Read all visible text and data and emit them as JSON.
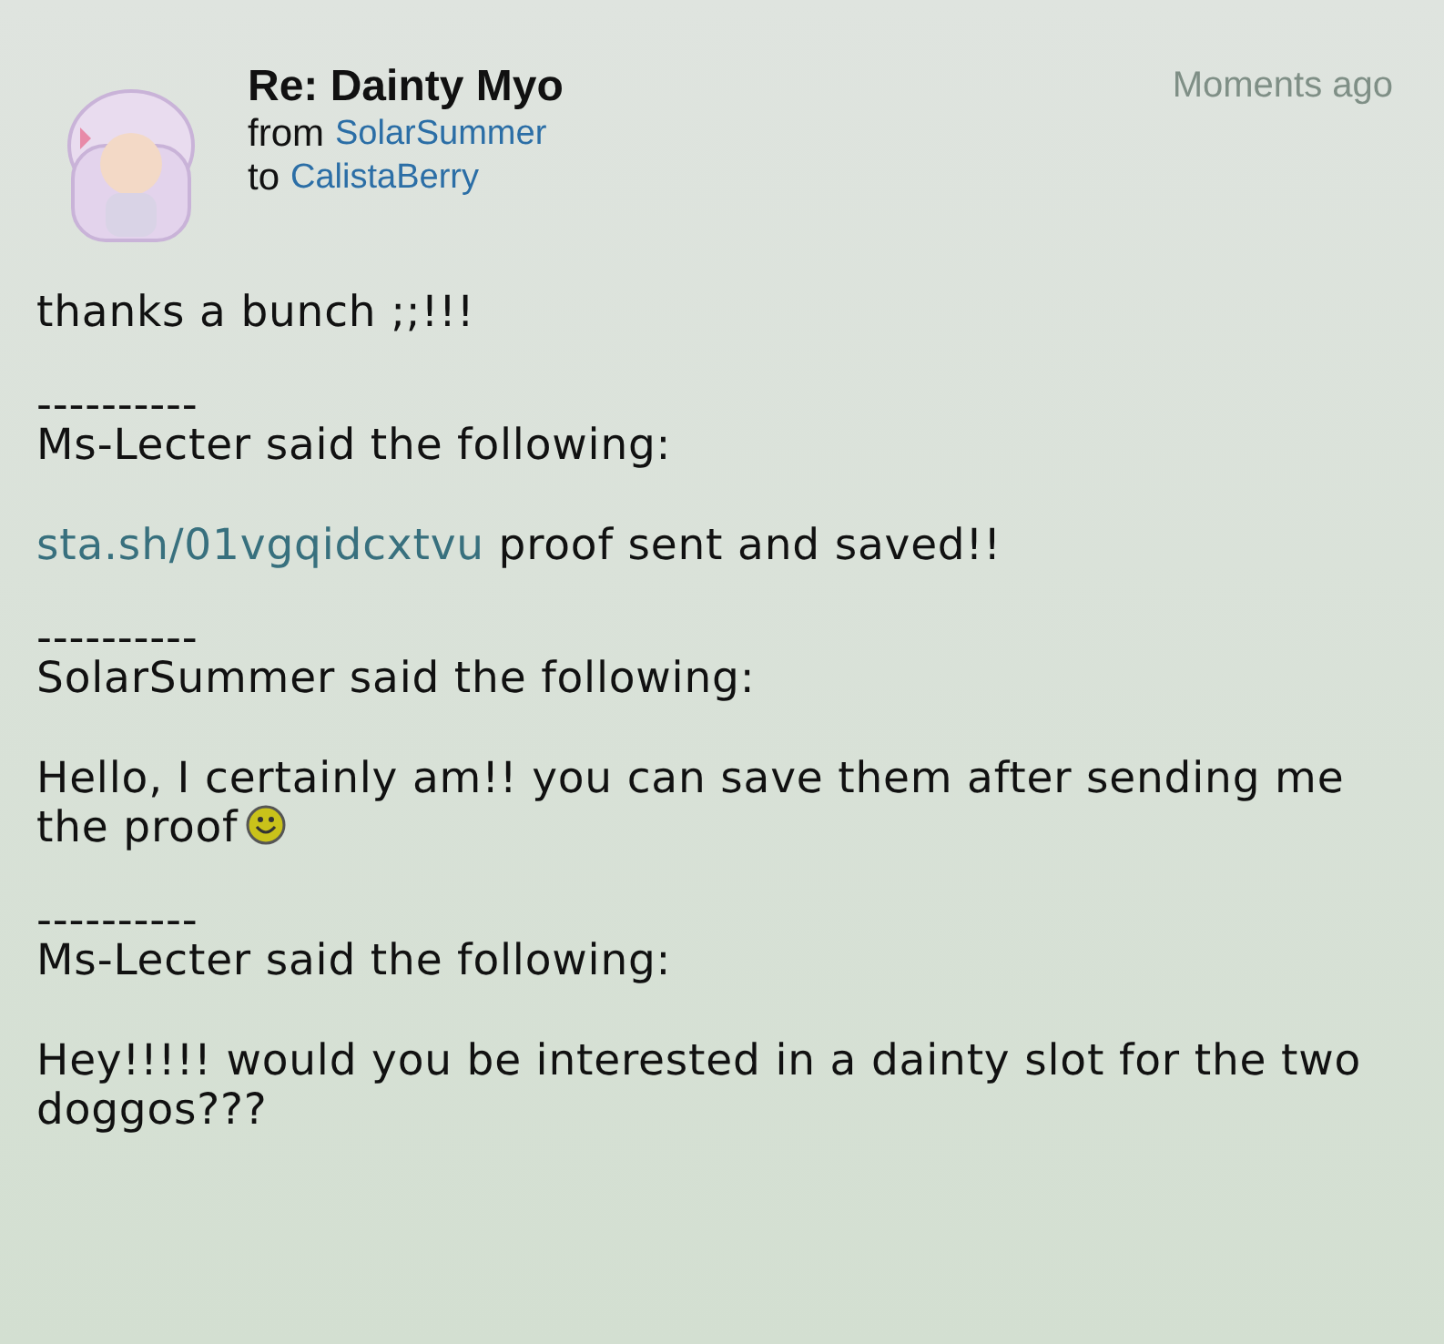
{
  "message": {
    "title": "Re: Dainty Myo",
    "from_label": "from",
    "sender": "SolarSummer",
    "to_label": "to",
    "recipient": "CalistaBerry",
    "time": "Moments ago"
  },
  "body": [
    {
      "kind": "text",
      "text": "thanks a bunch ;;!!!"
    },
    {
      "kind": "divider",
      "text": "----------"
    },
    {
      "kind": "attribution",
      "text": "Ms-Lecter said the following:"
    },
    {
      "kind": "link_text",
      "link": "sta.sh/01vgqidcxtvu",
      "text": "proof sent and saved!!"
    },
    {
      "kind": "divider",
      "text": "----------"
    },
    {
      "kind": "attribution",
      "text": "SolarSummer said the following:"
    },
    {
      "kind": "text",
      "text": "Hello, I certainly am!! you can save them after sending me the proof",
      "emoticon": true
    },
    {
      "kind": "divider",
      "text": "----------"
    },
    {
      "kind": "attribution",
      "text": "Ms-Lecter said the following:"
    },
    {
      "kind": "text",
      "text": "Hey!!!!! would you be interested in a dainty slot for the two doggos???"
    }
  ]
}
